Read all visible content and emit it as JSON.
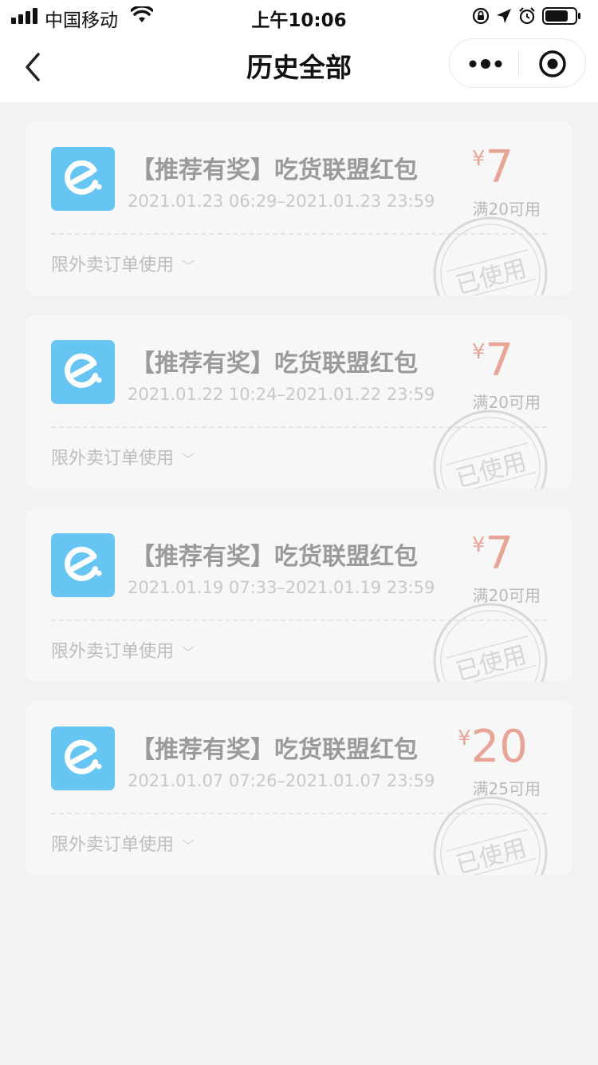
{
  "status_bar": {
    "carrier": "中国移动",
    "time": "上午10:06"
  },
  "nav": {
    "title": "历史全部"
  },
  "stamp_text": "已使用",
  "coupons": [
    {
      "title": "【推荐有奖】吃货联盟红包",
      "dates": "2021.01.23 06:29–2021.01.23 23:59",
      "currency": "¥",
      "amount": "7",
      "condition": "满20可用",
      "usage": "限外卖订单使用"
    },
    {
      "title": "【推荐有奖】吃货联盟红包",
      "dates": "2021.01.22 10:24–2021.01.22 23:59",
      "currency": "¥",
      "amount": "7",
      "condition": "满20可用",
      "usage": "限外卖订单使用"
    },
    {
      "title": "【推荐有奖】吃货联盟红包",
      "dates": "2021.01.19 07:33–2021.01.19 23:59",
      "currency": "¥",
      "amount": "7",
      "condition": "满20可用",
      "usage": "限外卖订单使用"
    },
    {
      "title": "【推荐有奖】吃货联盟红包",
      "dates": "2021.01.07 07:26–2021.01.07 23:59",
      "currency": "¥",
      "amount": "20",
      "condition": "满25可用",
      "usage": "限外卖订单使用"
    }
  ],
  "colors": {
    "logo": "#67c5f4",
    "price": "#e8a597"
  }
}
